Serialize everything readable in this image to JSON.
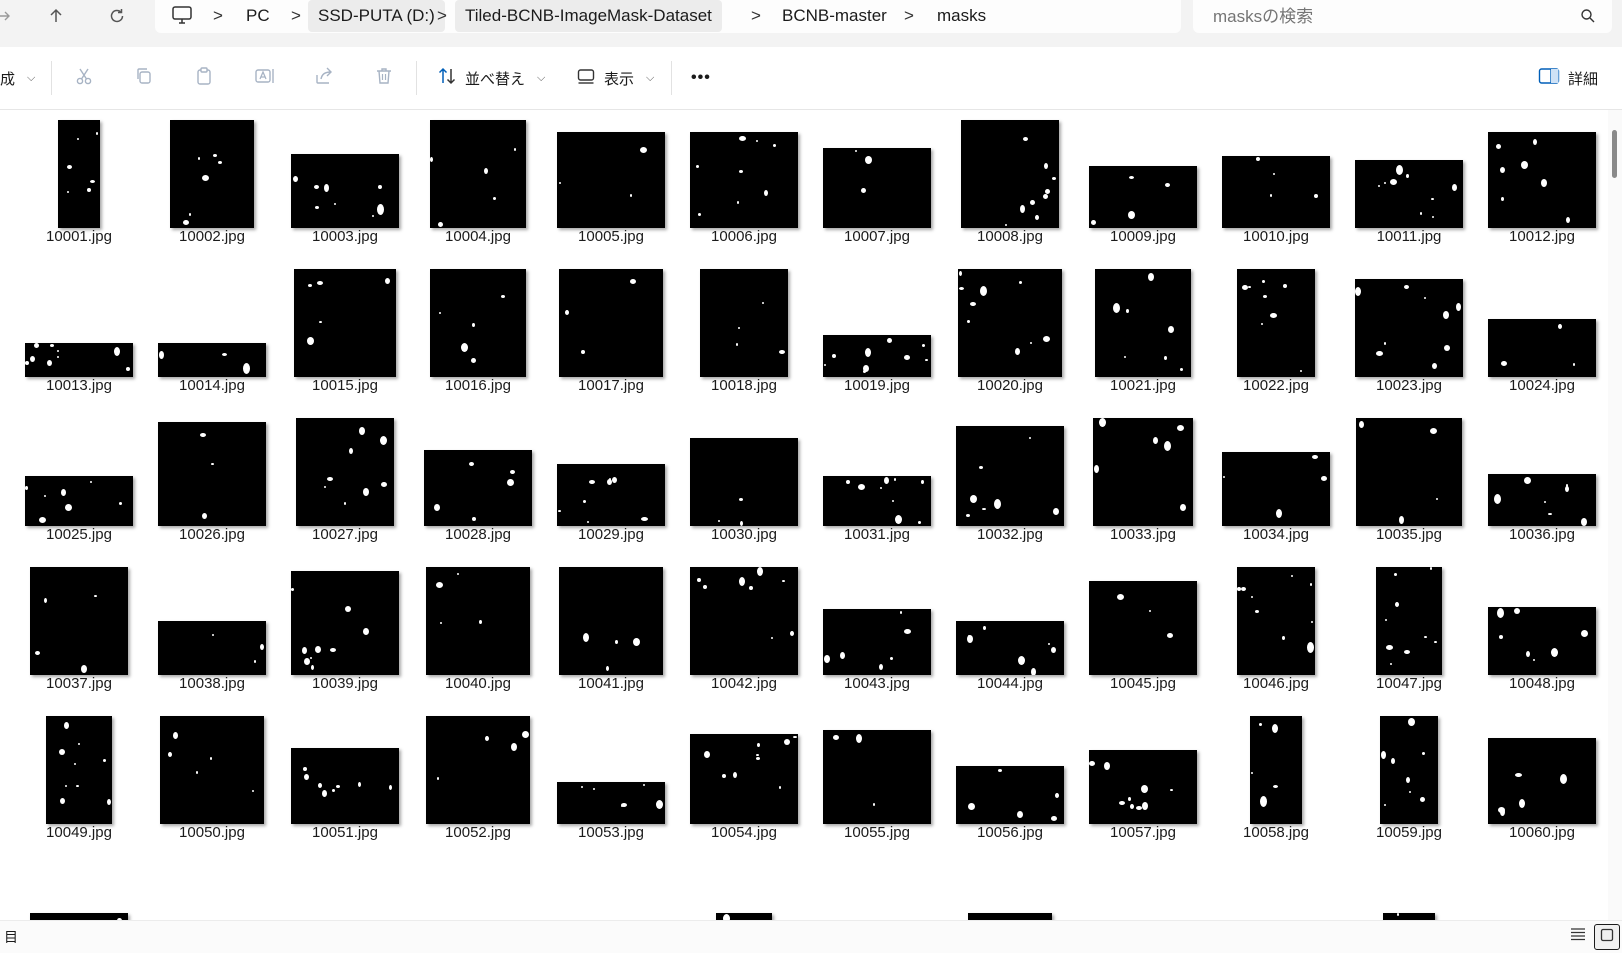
{
  "address": {
    "this_pc_icon": "computer-icon",
    "crumbs": [
      "PC",
      "SSD-PUTA (D:)",
      "Tiled-BCNB-ImageMask-Dataset",
      "BCNB-master",
      "masks"
    ],
    "separator": ">"
  },
  "search": {
    "placeholder": "masksの検索"
  },
  "toolbar": {
    "new_label": "成",
    "sort_label": "並べ替え",
    "view_label": "表示",
    "more_label": "•••",
    "details_label": "詳細",
    "disabled_icons": [
      "cut-icon",
      "copy-icon",
      "paste-icon",
      "rename-icon",
      "share-icon",
      "delete-icon"
    ]
  },
  "files": [
    "10001.jpg",
    "10002.jpg",
    "10003.jpg",
    "10004.jpg",
    "10005.jpg",
    "10006.jpg",
    "10007.jpg",
    "10008.jpg",
    "10009.jpg",
    "10010.jpg",
    "10011.jpg",
    "10012.jpg",
    "10013.jpg",
    "10014.jpg",
    "10015.jpg",
    "10016.jpg",
    "10017.jpg",
    "10018.jpg",
    "10019.jpg",
    "10020.jpg",
    "10021.jpg",
    "10022.jpg",
    "10023.jpg",
    "10024.jpg",
    "10025.jpg",
    "10026.jpg",
    "10027.jpg",
    "10028.jpg",
    "10029.jpg",
    "10030.jpg",
    "10031.jpg",
    "10032.jpg",
    "10033.jpg",
    "10034.jpg",
    "10035.jpg",
    "10036.jpg",
    "10037.jpg",
    "10038.jpg",
    "10039.jpg",
    "10040.jpg",
    "10041.jpg",
    "10042.jpg",
    "10043.jpg",
    "10044.jpg",
    "10045.jpg",
    "10046.jpg",
    "10047.jpg",
    "10048.jpg",
    "10049.jpg",
    "10050.jpg",
    "10051.jpg",
    "10052.jpg",
    "10053.jpg",
    "10054.jpg",
    "10055.jpg",
    "10056.jpg",
    "10057.jpg",
    "10058.jpg",
    "10059.jpg",
    "10060.jpg",
    "",
    "",
    "",
    "",
    "",
    "",
    "",
    "",
    "",
    "",
    "",
    ""
  ],
  "statusbar": {
    "left_label": "目"
  },
  "colors": {
    "accent": "#005fb8",
    "thumbnail": "#000000",
    "disabled_icon": "#a7b3c4"
  }
}
